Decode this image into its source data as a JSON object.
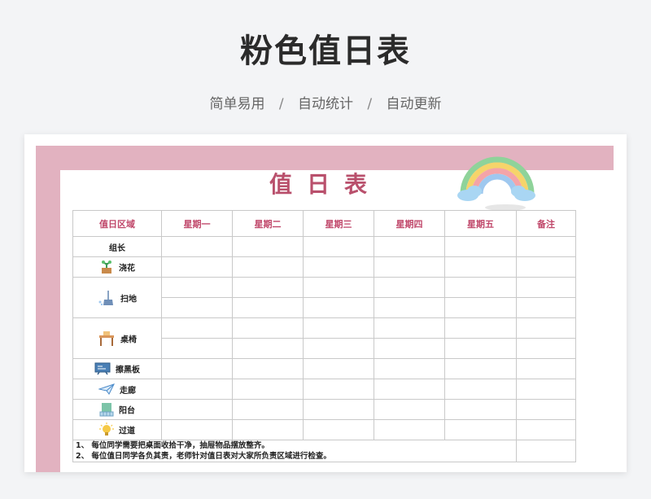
{
  "page": {
    "title": "粉色值日表",
    "subtitle": [
      "简单易用",
      "自动统计",
      "自动更新"
    ],
    "separator": "/"
  },
  "sheet": {
    "title": "值日表",
    "headers": [
      "值日区域",
      "星期一",
      "星期二",
      "星期三",
      "星期四",
      "星期五",
      "备注"
    ],
    "areas": [
      {
        "label": "组长",
        "icon": "none"
      },
      {
        "label": "浇花",
        "icon": "potted-plant-icon"
      },
      {
        "label": "扫地",
        "icon": "broom-icon"
      },
      {
        "label": "桌椅",
        "icon": "desk-icon"
      },
      {
        "label": "擦黑板",
        "icon": "blackboard-icon"
      },
      {
        "label": "走廊",
        "icon": "paper-plane-icon"
      },
      {
        "label": "阳台",
        "icon": "balcony-door-icon"
      },
      {
        "label": "过道",
        "icon": "lightbulb-icon"
      }
    ],
    "notes": [
      "1、 每位同学需要把桌面收拾干净，抽屉物品摆放整齐。",
      "2、 每位值日同学各负其责，老师针对值日表对大家所负责区域进行检查。"
    ]
  },
  "colors": {
    "frame_pink": "#e2b2c0",
    "title_rose": "#b9506c",
    "header_text": "#c0476a",
    "page_background": "#f3f4f6"
  }
}
